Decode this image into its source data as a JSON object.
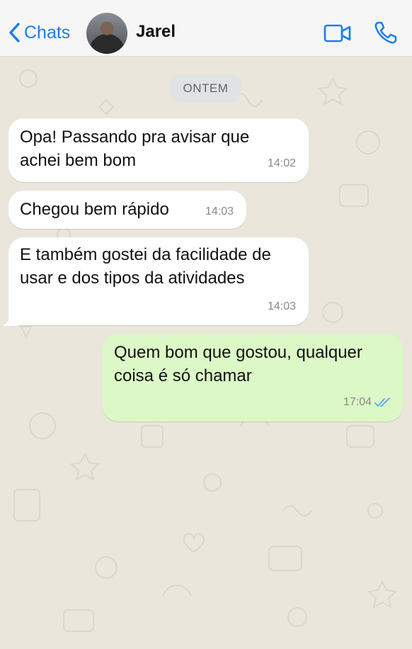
{
  "header": {
    "back_label": "Chats",
    "contact_name": "Jarel",
    "icons": [
      "chevron-left-icon",
      "video-call-icon",
      "phone-icon"
    ],
    "accent_color": "#1a7cf0"
  },
  "day_separator": "ONTEM",
  "messages": [
    {
      "direction": "in",
      "lines": [
        "Opa! Passando pra avisar que",
        "achei bem bom"
      ],
      "time": "14:02"
    },
    {
      "direction": "in",
      "lines": [
        "Chegou bem rápido"
      ],
      "time": "14:03"
    },
    {
      "direction": "in",
      "lines": [
        "E também gostei da facilidade de",
        "usar e dos tipos da atividades"
      ],
      "time": "14:03"
    },
    {
      "direction": "out",
      "lines": [
        "Quem bom que gostou, qualquer",
        "coisa é só chamar"
      ],
      "time": "17:04",
      "status": "read"
    }
  ],
  "colors": {
    "incoming_bubble": "#ffffff",
    "outgoing_bubble": "#dcf8c6",
    "read_ticks": "#4fa8f0",
    "wallpaper": "#ebe6dc"
  }
}
